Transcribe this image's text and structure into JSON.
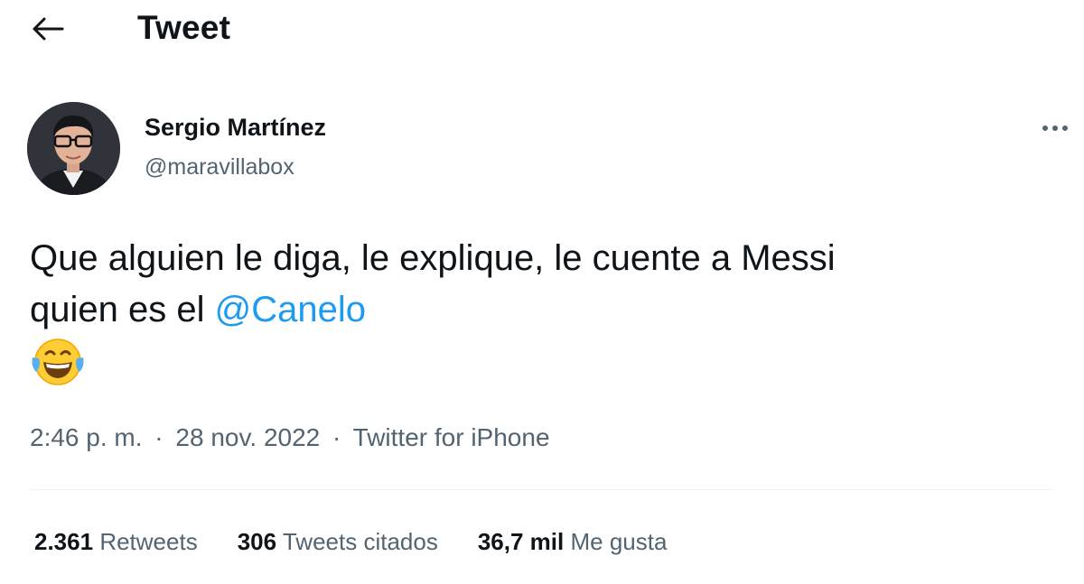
{
  "header": {
    "back_icon": "arrow-left-icon",
    "title": "Tweet"
  },
  "author": {
    "name": "Sergio Martínez",
    "handle": "@maravillabox"
  },
  "tweet": {
    "text_line1": "Que alguien le diga, le explique, le cuente a Messi",
    "text_line2_prefix": "quien es el ",
    "mention": "@Canelo",
    "emoji": "😂",
    "emoji_icon": "face-with-tears-of-joy-icon"
  },
  "meta": {
    "time": "2:46 p. m.",
    "separator": "·",
    "date": "28 nov. 2022",
    "source": "Twitter for iPhone"
  },
  "stats": {
    "retweets_count": "2.361",
    "retweets_label": "Retweets",
    "quotes_count": "306",
    "quotes_label": "Tweets citados",
    "likes_count": "36,7 mil",
    "likes_label": "Me gusta"
  },
  "colors": {
    "link": "#1d9bf0",
    "text": "#0f1419",
    "secondary_text": "#536471",
    "divider": "#eff3f4"
  }
}
